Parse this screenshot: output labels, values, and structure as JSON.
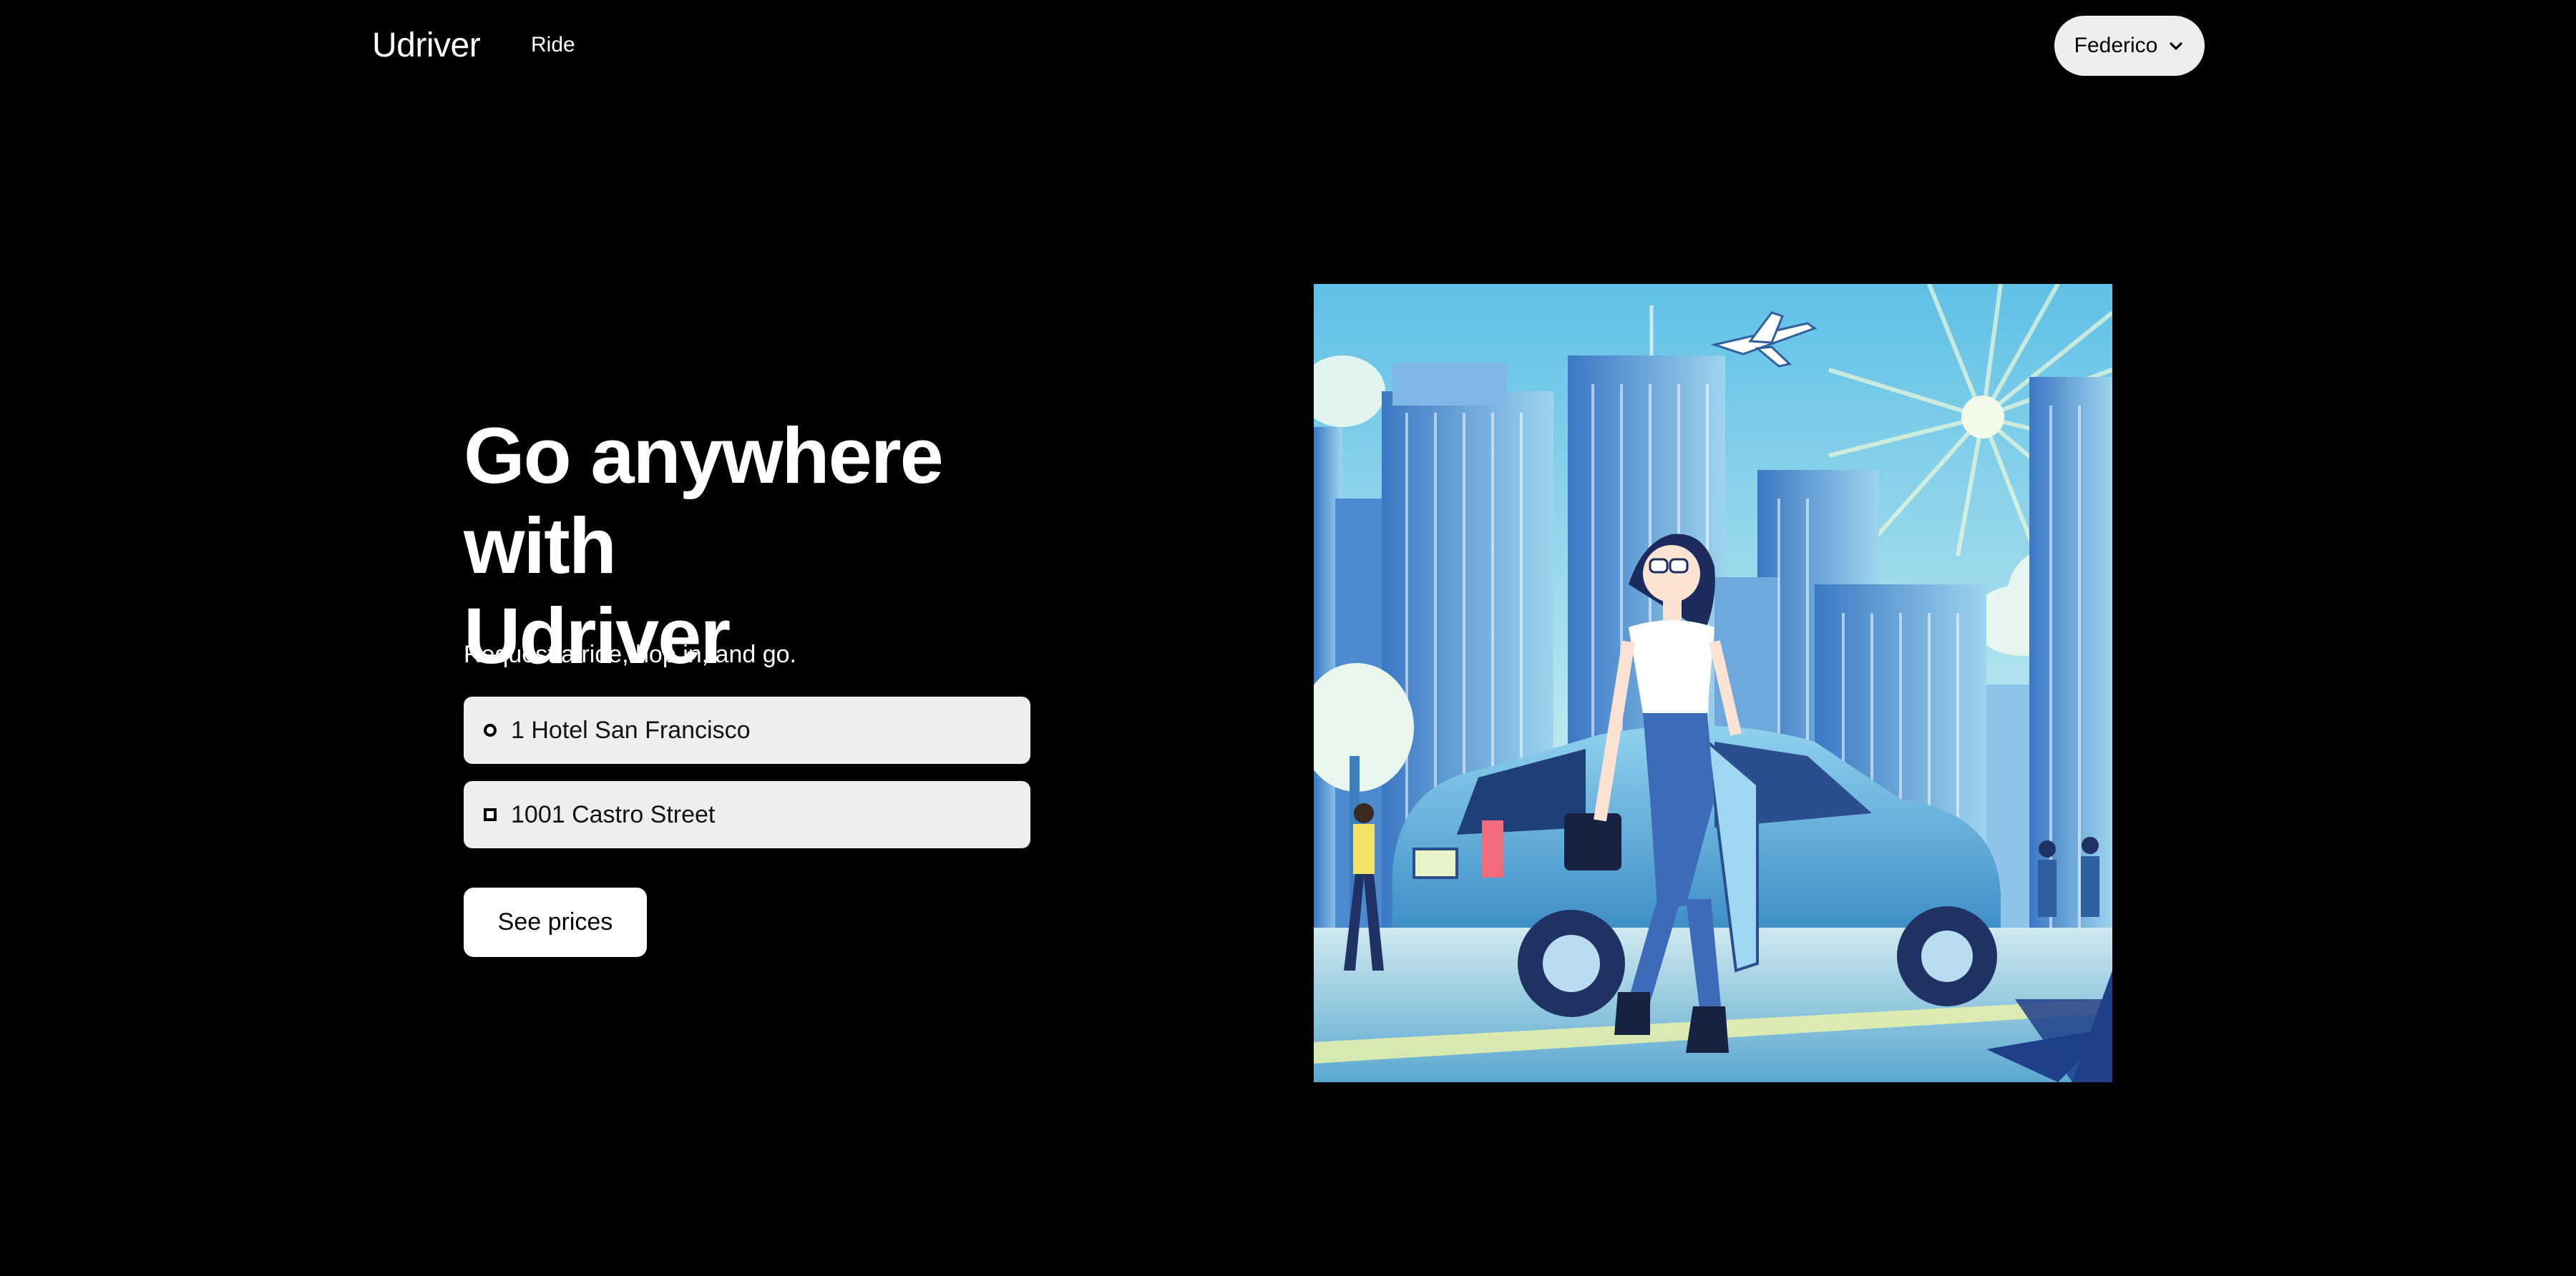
{
  "app": {
    "brand": "Udriver"
  },
  "nav": {
    "ride_label": "Ride"
  },
  "user": {
    "name": "Federico"
  },
  "hero": {
    "headline_line1": "Go anywhere with",
    "headline_line2": "Udriver",
    "subhead": "Request a ride, hop in, and go."
  },
  "trip": {
    "pickup_value": "1 Hotel San Francisco",
    "dropoff_value": "1001 Castro Street",
    "cta_label": "See prices"
  },
  "icons": {
    "user_menu": "chevron-down-icon",
    "pickup": "pickup-circle-icon",
    "dropoff": "dropoff-square-icon"
  },
  "colors": {
    "background": "#000000",
    "field_bg": "#eeeeee",
    "button_bg": "#ffffff",
    "text_primary": "#ffffff"
  }
}
